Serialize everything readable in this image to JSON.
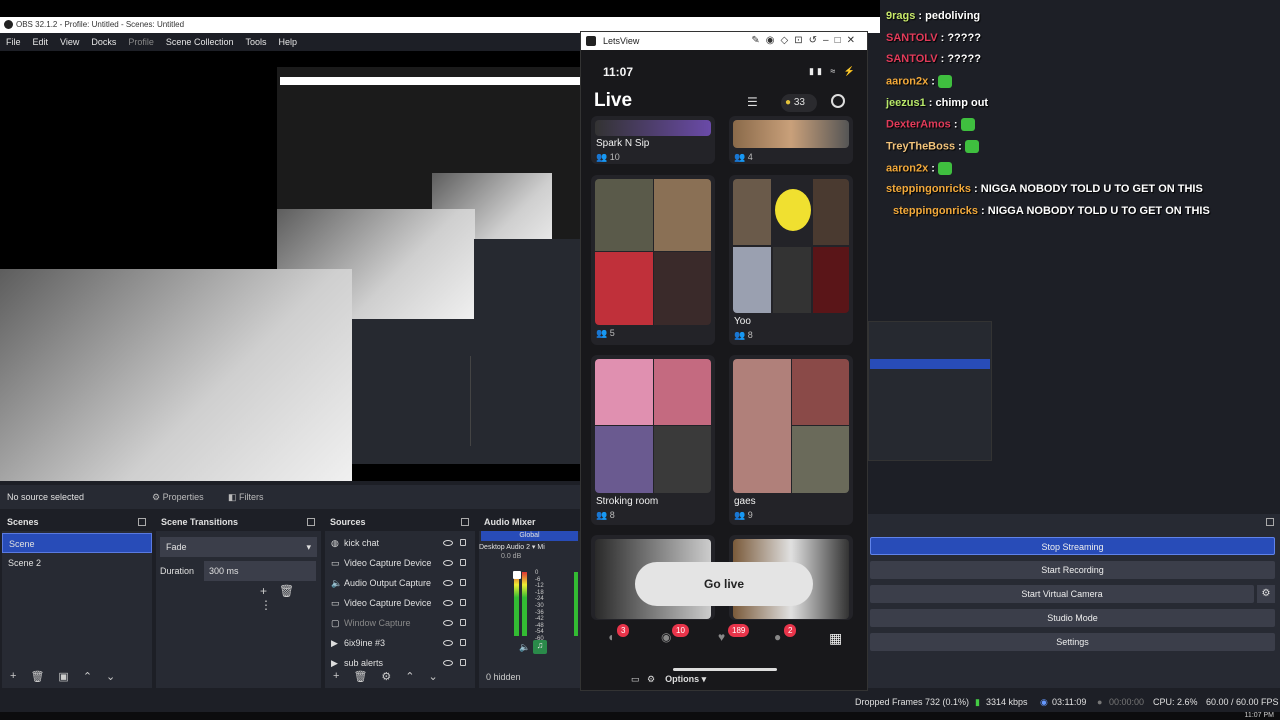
{
  "obs": {
    "title": "OBS 32.1.2 - Profile: Untitled - Scenes: Untitled",
    "menu": [
      "File",
      "Edit",
      "View",
      "Docks",
      "Profile",
      "Scene Collection",
      "Tools",
      "Help"
    ],
    "source_status": "No source selected",
    "properties_label": "Properties",
    "filters_label": "Filters",
    "scenes": {
      "title": "Scenes",
      "items": [
        "Scene",
        "Scene 2"
      ]
    },
    "transitions": {
      "title": "Scene Transitions",
      "type": "Fade",
      "duration_label": "Duration",
      "duration_value": "300 ms"
    },
    "sources": {
      "title": "Sources",
      "items": [
        {
          "icon": "globe-icon",
          "label": "kick chat"
        },
        {
          "icon": "camera-icon",
          "label": "Video Capture Device"
        },
        {
          "icon": "speaker-icon",
          "label": "Audio Output Capture"
        },
        {
          "icon": "camera-icon",
          "label": "Video Capture Device"
        },
        {
          "icon": "window-icon",
          "label": "Window Capture"
        },
        {
          "icon": "play-icon",
          "label": "6ix9ine #3"
        },
        {
          "icon": "play-icon",
          "label": "sub alerts"
        }
      ]
    },
    "mixer": {
      "title": "Audio Mixer",
      "tab": "Global",
      "channel1": "Desktop Audio 2",
      "channel2": "Mi",
      "db": "0.0 dB",
      "scale": [
        "0",
        "-6",
        "-12",
        "-18",
        "-24",
        "-30",
        "-36",
        "-42",
        "-48",
        "-54",
        "-60"
      ]
    },
    "hidden": "0 hidden",
    "controls": {
      "stop_streaming": "Stop Streaming",
      "start_recording": "Start Recording",
      "start_virtual_camera": "Start Virtual Camera",
      "studio_mode": "Studio Mode",
      "settings": "Settings"
    },
    "options_label": "Options",
    "status": {
      "dropped": "Dropped Frames 732 (0.1%)",
      "bitrate": "3314 kbps",
      "stream_time": "03:11:09",
      "rec_time": "00:00:00",
      "cpu": "CPU: 2.6%",
      "fps": "60.00 / 60.00 FPS"
    },
    "clock": "11:07 PM"
  },
  "letsview": {
    "title": "LetsView",
    "phone_time": "11:07",
    "heading": "Live",
    "coins": "33",
    "tiles": [
      {
        "title": "Spark N Sip",
        "count": "10"
      },
      {
        "title": "",
        "count": "4"
      },
      {
        "title": "",
        "count": "5"
      },
      {
        "title": "Yoo",
        "count": "8"
      },
      {
        "title": "Stroking room",
        "count": "8"
      },
      {
        "title": "gaes",
        "count": "9"
      }
    ],
    "go_live": "Go live",
    "badges": [
      "3",
      "10",
      "189",
      "2"
    ]
  },
  "chat": [
    {
      "user": "9rags",
      "msg": "pedoliving",
      "color": "#c8e86a"
    },
    {
      "user": "SANTOLV",
      "msg": "?????",
      "color": "#e23b5a"
    },
    {
      "user": "SANTOLV",
      "msg": "?????",
      "color": "#e23b5a"
    },
    {
      "user": "aaron2x",
      "msg": "",
      "color": "#f2a93b"
    },
    {
      "user": "jeezus1",
      "msg": "chimp out",
      "color": "#b8e86a"
    },
    {
      "user": "DexterAmos",
      "msg": "",
      "color": "#e23b5a"
    },
    {
      "user": "TreyTheBoss",
      "msg": "",
      "color": "#f2c37b"
    },
    {
      "user": "aaron2x",
      "msg": "",
      "color": "#f2a93b"
    },
    {
      "user": "steppingonricks",
      "msg": "NIGGA NOBODY TOLD U TO GET ON THIS",
      "color": "#f2a93b"
    },
    {
      "user": "steppingonricks",
      "msg": "NIGGA NOBODY TOLD U TO GET ON THIS",
      "color": "#f2a93b"
    }
  ]
}
